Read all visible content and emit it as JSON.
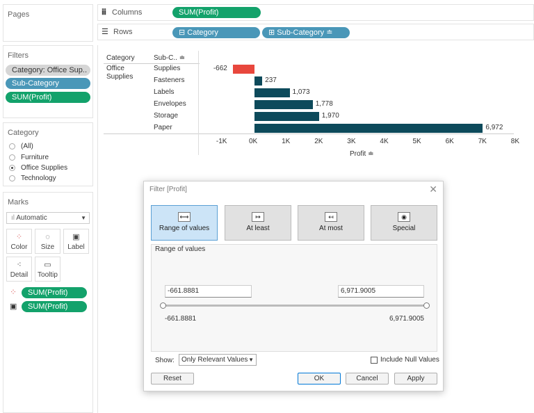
{
  "pages": {
    "title": "Pages"
  },
  "filters": {
    "title": "Filters",
    "pills": [
      "Category: Office Sup..",
      "Sub-Category",
      "SUM(Profit)"
    ]
  },
  "category_filter": {
    "title": "Category",
    "options": [
      "(All)",
      "Furniture",
      "Office Supplies",
      "Technology"
    ],
    "selected": "Office Supplies"
  },
  "marks": {
    "title": "Marks",
    "type": "Automatic",
    "buttons": [
      "Color",
      "Size",
      "Label",
      "Detail",
      "Tooltip"
    ],
    "pills": [
      "SUM(Profit)",
      "SUM(Profit)"
    ]
  },
  "shelves": {
    "columns_label": "Columns",
    "columns_pill": "SUM(Profit)",
    "rows_label": "Rows",
    "rows_pills": [
      "Category",
      "Sub-Category"
    ]
  },
  "view": {
    "header_category": "Category",
    "header_subcategory": "Sub-C..",
    "category_value": "Office Supplies",
    "axis_title": "Profit",
    "neg_color": "#e8473d",
    "pos_color": "#0d4a5b",
    "chart_data": {
      "type": "bar",
      "orientation": "horizontal",
      "categories": [
        "Supplies",
        "Fasteners",
        "Labels",
        "Envelopes",
        "Storage",
        "Paper"
      ],
      "values": [
        -662,
        237,
        1073,
        1778,
        1970,
        6972
      ],
      "labels": [
        "-662",
        "237",
        "1,073",
        "1,778",
        "1,970",
        "6,972"
      ],
      "xlabel": "Profit",
      "xlim": [
        -1000,
        8000
      ],
      "ticks": [
        "-1K",
        "0K",
        "1K",
        "2K",
        "3K",
        "4K",
        "5K",
        "6K",
        "7K",
        "8K"
      ]
    }
  },
  "dialog": {
    "title": "Filter [Profit]",
    "tabs": [
      "Range of values",
      "At least",
      "At most",
      "Special"
    ],
    "selected_tab": "Range of values",
    "group_title": "Range of values",
    "min_value": "-661.8881",
    "max_value": "6,971.9005",
    "min_label": "-661.8881",
    "max_label": "6,971.9005",
    "show_label": "Show:",
    "show_value": "Only Relevant Values",
    "include_null": "Include Null Values",
    "include_null_checked": false,
    "buttons": {
      "reset": "Reset",
      "ok": "OK",
      "cancel": "Cancel",
      "apply": "Apply"
    }
  }
}
